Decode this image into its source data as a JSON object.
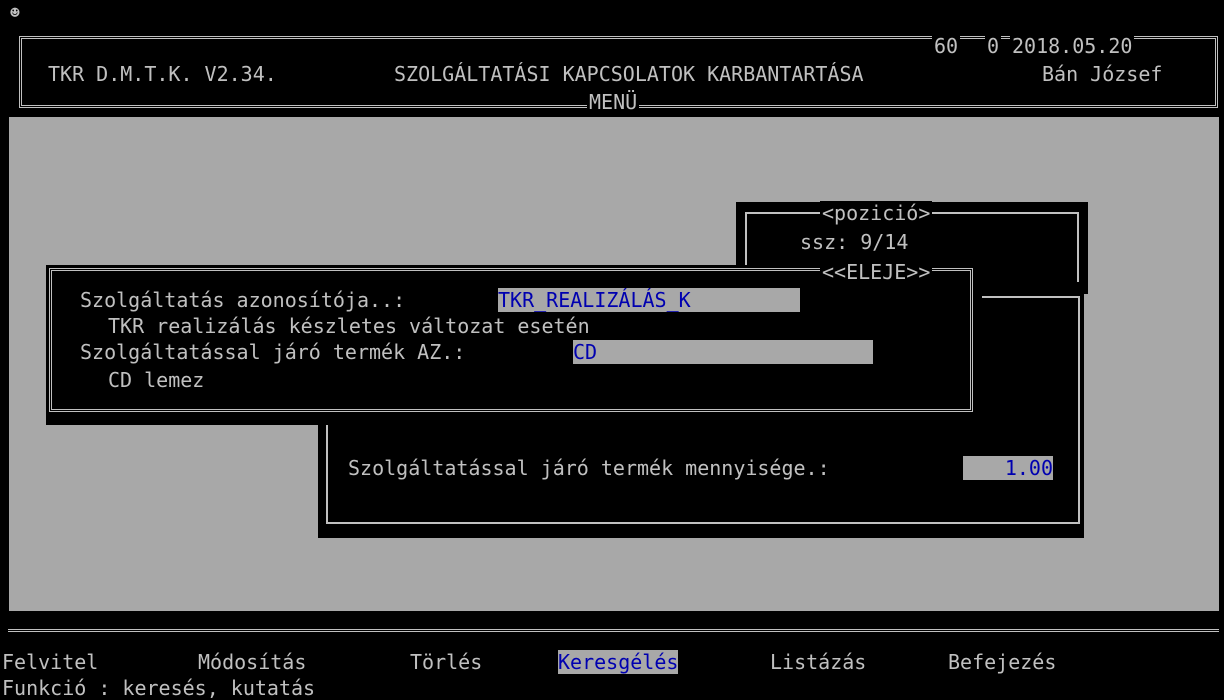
{
  "window": {
    "icon": "terminal-smiley-icon"
  },
  "header": {
    "app_title": "TKR D.M.T.K. V2.34.",
    "screen_title": "SZOLGÁLTATÁSI KAPCSOLATOK KARBANTARTÁSA",
    "counter_a": "60",
    "counter_b": "0",
    "date": "2018.05.20",
    "user": "Bán József",
    "menu_label": "MENÜ"
  },
  "position_box": {
    "title": "<pozició>",
    "record": "ssz: 9/14",
    "bottom_tag": "<<ELEJE>>"
  },
  "form": {
    "service_id_label": "Szolgáltatás azonosítója..:",
    "service_id_value": "TKR_REALIZÁLÁS_K",
    "service_desc": "TKR realizálás készletes változat esetén",
    "product_id_label": "Szolgáltatással járó termék AZ.:",
    "product_id_value": "CD",
    "product_desc": "CD lemez"
  },
  "quantity": {
    "label": "Szolgáltatással járó termék mennyisége.:",
    "value": "1.00"
  },
  "menu": {
    "items": [
      "Felvitel",
      "Módosítás",
      "Törlés",
      "Keresgélés",
      "Listázás",
      "Befejezés"
    ],
    "selected": "Keresgélés",
    "function_line": "Funkció : keresés, kutatás"
  },
  "colors": {
    "highlight_bg": "#a8a8a8",
    "highlight_fg": "#0000b0",
    "text": "#c0c0c0",
    "background": "#000000"
  }
}
